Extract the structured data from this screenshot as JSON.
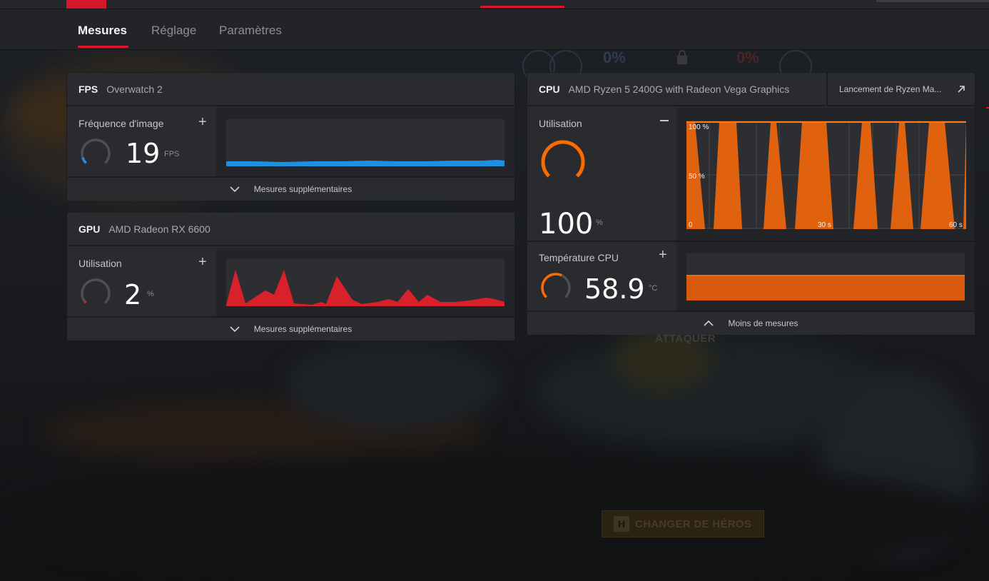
{
  "tabs": [
    {
      "label": "Mesures",
      "active": true
    },
    {
      "label": "Réglage",
      "active": false
    },
    {
      "label": "Paramètres",
      "active": false
    }
  ],
  "fps_panel": {
    "tag": "FPS",
    "subtitle": "Overwatch 2",
    "metric_label": "Fréquence d'image",
    "value": "19",
    "unit": "FPS",
    "more_label": "Mesures supplémentaires",
    "gauge_level": 0.1,
    "color": "#1f8fe0"
  },
  "gpu_panel": {
    "tag": "GPU",
    "subtitle": "AMD Radeon RX 6600",
    "metric_label": "Utilisation",
    "value": "2",
    "unit": "%",
    "more_label": "Mesures supplémentaires",
    "gauge_level": 0.02,
    "color": "#d9212b"
  },
  "cpu_panel": {
    "tag": "CPU",
    "subtitle": "AMD Ryzen 5 2400G with Radeon Vega Graphics",
    "launch_label": "Lancement de Ryzen Ma...",
    "metric_label": "Utilisation",
    "value": "100",
    "unit": "%",
    "gauge_level": 1.0,
    "color": "#ff6a00",
    "chart_labels": {
      "y_top": "100 %",
      "y_mid": "50 %",
      "x_start": "0",
      "x_mid": "30 s",
      "x_end": "60 s"
    },
    "temp_label": "Température CPU",
    "temp_value": "58.9",
    "temp_unit": "°C",
    "temp_gauge_level": 0.59,
    "less_label": "Moins de mesures"
  },
  "background": {
    "hud_left": "0%",
    "hud_right": "0%",
    "attack_text": "ATTAQUER",
    "hero_key": "H",
    "hero_button": "CHANGER DE HÉROS"
  },
  "icons": [
    "plus-icon",
    "minus-icon",
    "chevron-down-icon",
    "chevron-up-icon",
    "external-link-icon",
    "lock-icon"
  ]
}
